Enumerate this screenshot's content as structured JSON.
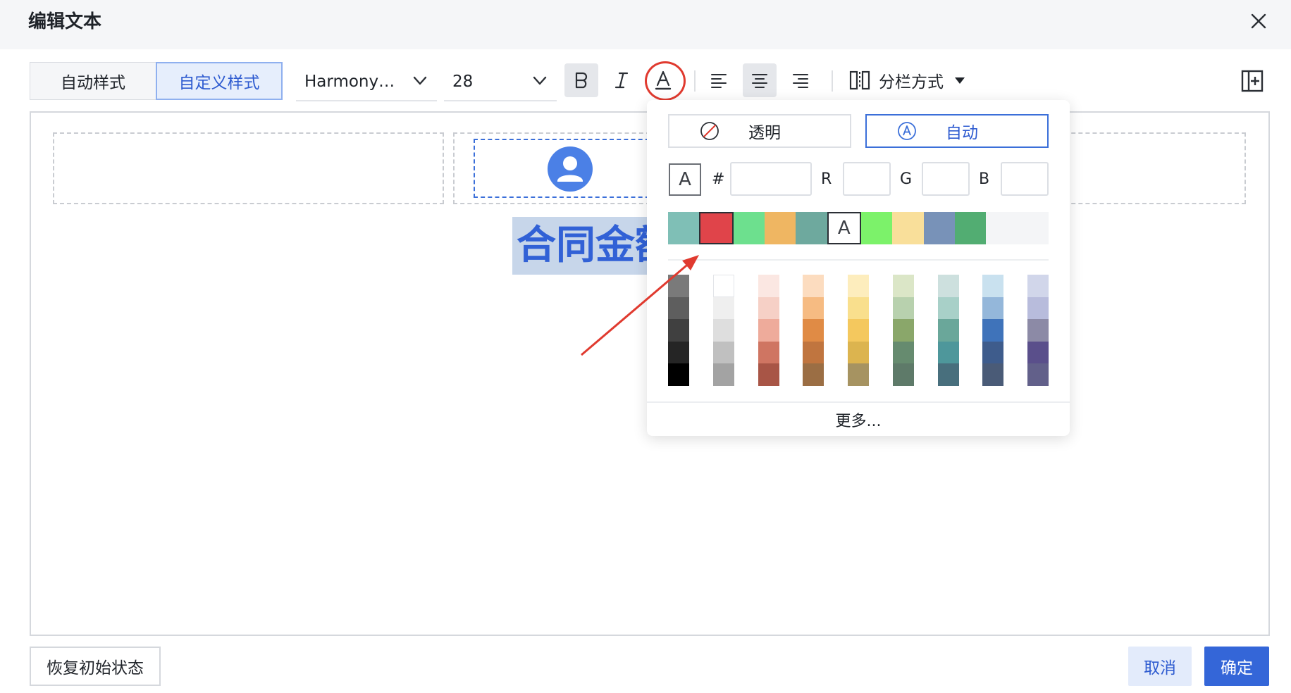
{
  "dialog": {
    "title": "编辑文本"
  },
  "toolbar": {
    "style_tabs": [
      {
        "label": "自动样式"
      },
      {
        "label": "自定义样式"
      }
    ],
    "font_family": "Harmony…",
    "font_size": "28",
    "columns_label": "分栏方式",
    "active_buttons": [
      "bold-button",
      "align-center-button"
    ]
  },
  "canvas": {
    "selected_text": "合同金额",
    "selection_highlight": "#c7d6ea",
    "text_color": "#3161d6"
  },
  "color_picker": {
    "transparent_label": "透明",
    "auto_label": "自动",
    "hash_label": "#",
    "r_label": "R",
    "g_label": "G",
    "b_label": "B",
    "hex_value": "",
    "r_value": "",
    "g_value": "",
    "b_value": "",
    "recent_colors": [
      "#7fbfb6",
      "#e0444a",
      "#6de08e",
      "#efb662",
      "#6ea99e",
      "auto",
      "#7cf26a",
      "#f9df9a",
      "#7892b8",
      "#52ad72",
      "#f4f5f7",
      "#f4f5f7"
    ],
    "selected_recent_index": 1,
    "palette": [
      [
        "#7a7a7a",
        "#5e5e5e",
        "#404040",
        "#252525",
        "#000000"
      ],
      [
        "#ffffff",
        "#efefef",
        "#dedede",
        "#c0c0c0",
        "#a3a3a3"
      ],
      [
        "#fbe7e2",
        "#f6d0c6",
        "#eeab9b",
        "#cf7562",
        "#a85546"
      ],
      [
        "#fcdcbf",
        "#f6bb82",
        "#e08b45",
        "#c0753f",
        "#9b6e44"
      ],
      [
        "#fdedbd",
        "#f9df8d",
        "#f4c85e",
        "#dcb44f",
        "#a69361"
      ],
      [
        "#dbe6c7",
        "#b8d1ae",
        "#8aa76a",
        "#668b6f",
        "#5e7a69"
      ],
      [
        "#cde0de",
        "#a8d0c8",
        "#6aa79a",
        "#4e979b",
        "#486f7d"
      ],
      [
        "#c9e1ef",
        "#94b7da",
        "#3f73ba",
        "#3e5c8c",
        "#4a5b77"
      ],
      [
        "#d1d6ea",
        "#b8bcdc",
        "#8c8aa6",
        "#5a4f8b",
        "#62608a"
      ]
    ],
    "more_label": "更多..."
  },
  "footer": {
    "reset_label": "恢复初始状态",
    "cancel_label": "取消",
    "ok_label": "确定"
  },
  "colors": {
    "accent": "#3466d8",
    "annotation_red": "#e03a2f"
  }
}
